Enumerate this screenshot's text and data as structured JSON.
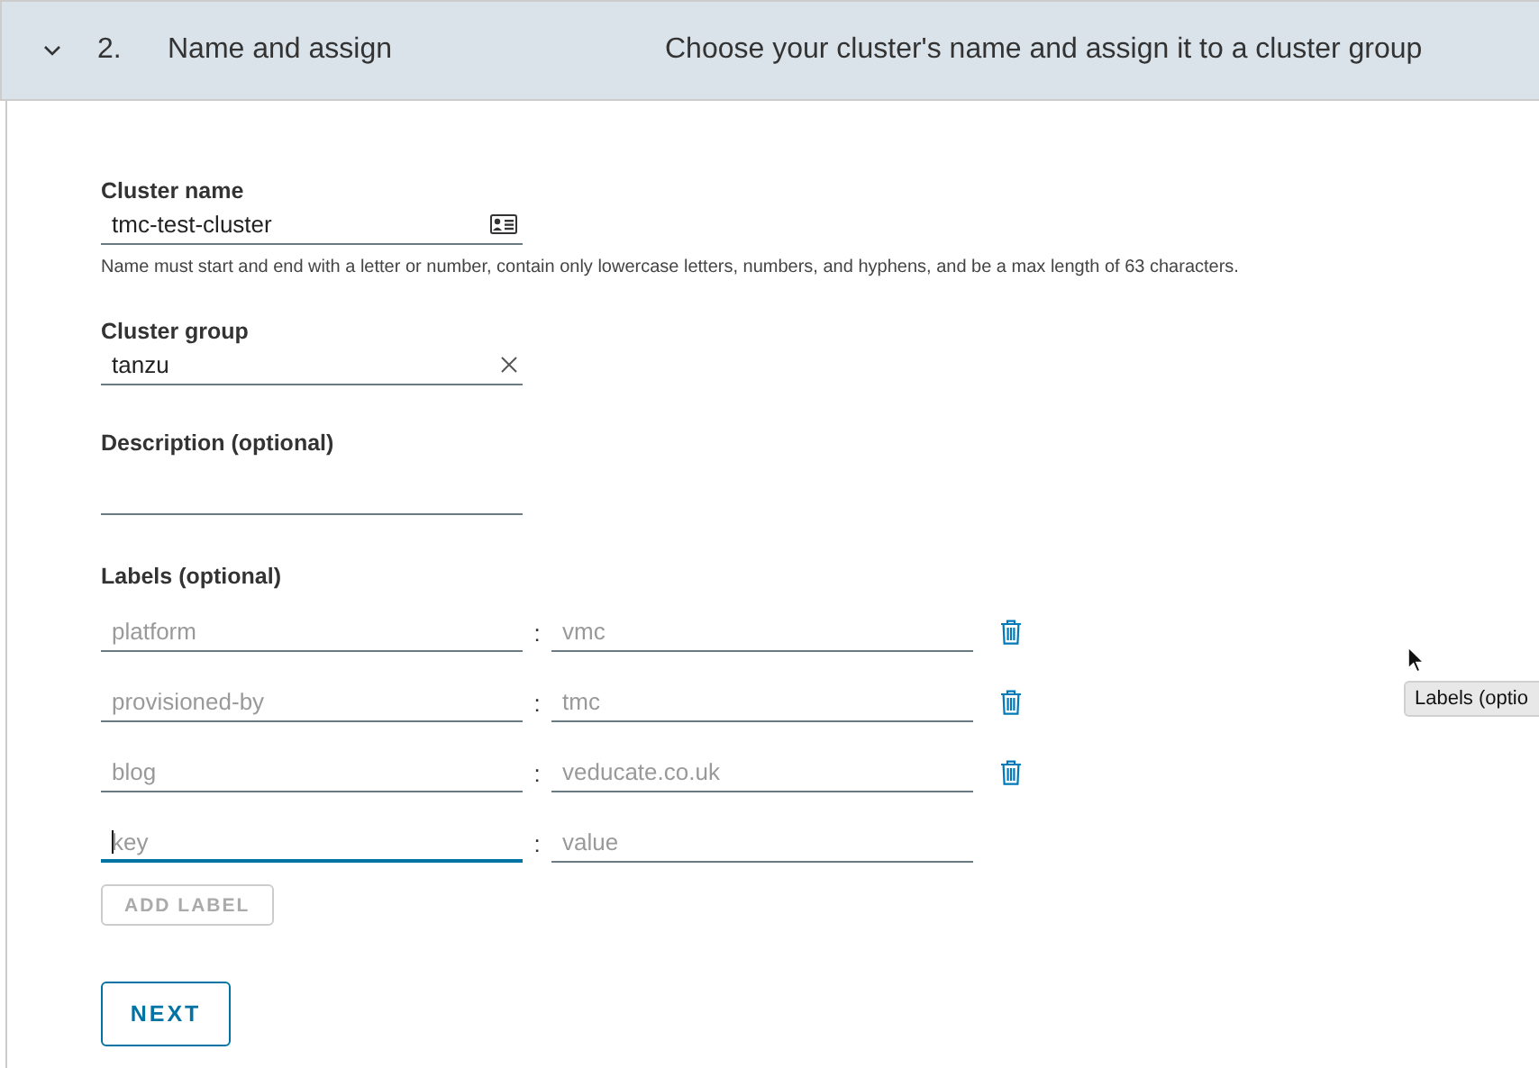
{
  "step": {
    "expanded": true,
    "number": "2.",
    "title": "Name and assign",
    "description": "Choose your cluster's name and assign it to a cluster group"
  },
  "cluster_name": {
    "label": "Cluster name",
    "value": "tmc-test-cluster",
    "hint": "Name must start and end with a letter or number, contain only lowercase letters, numbers, and hyphens, and be a max length of 63 characters."
  },
  "cluster_group": {
    "label": "Cluster group",
    "value": "tanzu"
  },
  "description": {
    "label": "Description (optional)"
  },
  "labels": {
    "label": "Labels (optional)",
    "separator": ":",
    "rows": [
      {
        "key": "platform",
        "value": "vmc",
        "disabled": true
      },
      {
        "key": "provisioned-by",
        "value": "tmc",
        "disabled": true
      },
      {
        "key": "blog",
        "value": "veducate.co.uk",
        "disabled": true
      }
    ],
    "new_row": {
      "key_placeholder": "key",
      "value_placeholder": "value",
      "focused": true
    },
    "add_button": {
      "label": "ADD LABEL",
      "disabled": true
    }
  },
  "next_button": "NEXT",
  "tooltip": "Labels (optio"
}
